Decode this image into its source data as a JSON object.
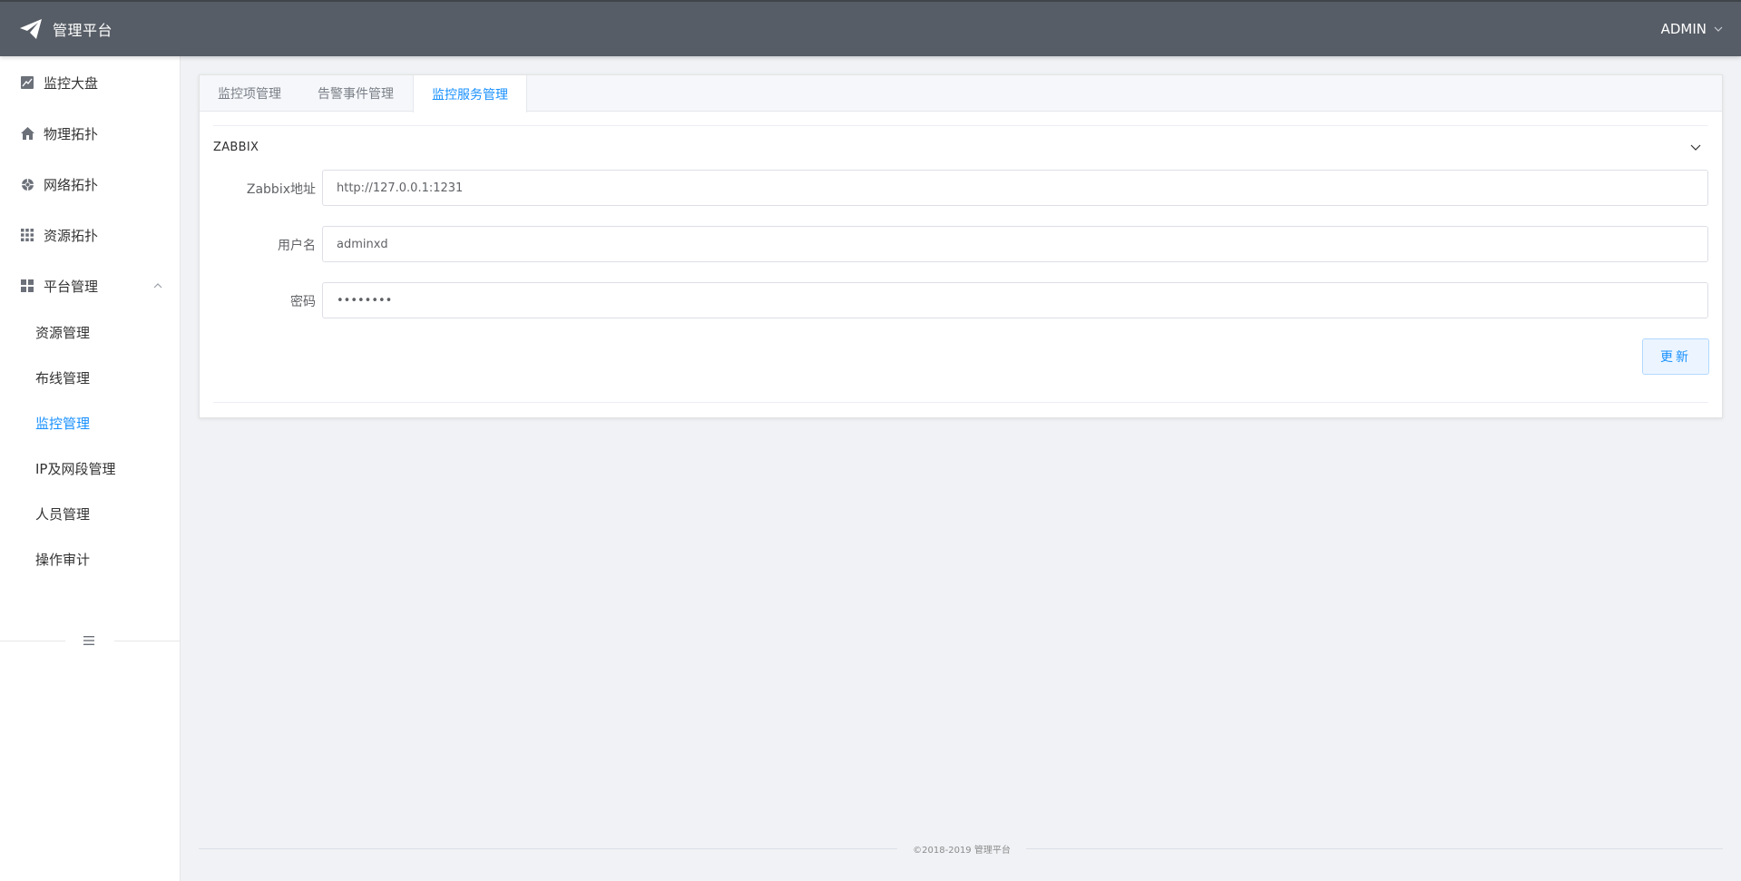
{
  "header": {
    "app_title": "管理平台",
    "user_name": "ADMIN",
    "logo_icon": "paper-plane-icon",
    "background_color": "#575d66"
  },
  "sidebar": {
    "menu": [
      {
        "label": "监控大盘",
        "icon": "chart-icon"
      },
      {
        "label": "物理拓扑",
        "icon": "home-icon"
      },
      {
        "label": "网络拓扑",
        "icon": "network-icon"
      },
      {
        "label": "资源拓扑",
        "icon": "grid-icon"
      },
      {
        "label": "平台管理",
        "icon": "apps-icon",
        "expanded": true
      }
    ],
    "submenu": [
      {
        "label": "资源管理"
      },
      {
        "label": "布线管理"
      },
      {
        "label": "监控管理",
        "active": true
      },
      {
        "label": "IP及网段管理"
      },
      {
        "label": "人员管理"
      },
      {
        "label": "操作审计"
      }
    ],
    "collapse_icon": "collapse-menu-icon"
  },
  "tabs": [
    {
      "label": "监控项管理"
    },
    {
      "label": "告警事件管理"
    },
    {
      "label": "监控服务管理",
      "active": true
    }
  ],
  "zabbix": {
    "title": "ZABBIX",
    "fields": {
      "address": {
        "label": "Zabbix地址",
        "value": "http://127.0.0.1:1231"
      },
      "username": {
        "label": "用户名",
        "value": "adminxd"
      },
      "password": {
        "label": "密码",
        "value": "••••••••"
      }
    },
    "update_label": "更新"
  },
  "footer": {
    "text": "©2018-2019 管理平台"
  },
  "colors": {
    "accent": "#1890ff",
    "page_bg": "#f0f2f5"
  }
}
